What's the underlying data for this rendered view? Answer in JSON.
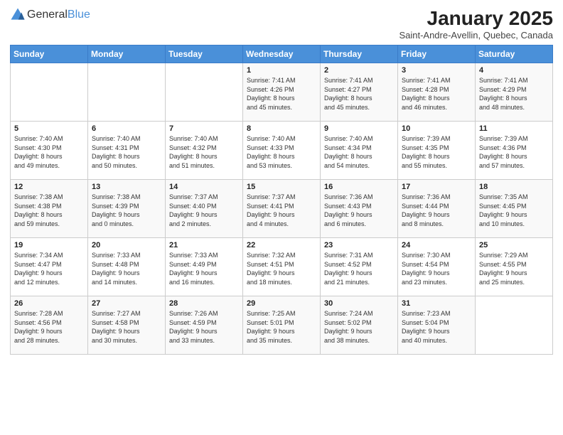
{
  "header": {
    "logo_general": "General",
    "logo_blue": "Blue",
    "month_title": "January 2025",
    "location": "Saint-Andre-Avellin, Quebec, Canada"
  },
  "weekdays": [
    "Sunday",
    "Monday",
    "Tuesday",
    "Wednesday",
    "Thursday",
    "Friday",
    "Saturday"
  ],
  "weeks": [
    [
      {
        "day": "",
        "info": ""
      },
      {
        "day": "",
        "info": ""
      },
      {
        "day": "",
        "info": ""
      },
      {
        "day": "1",
        "info": "Sunrise: 7:41 AM\nSunset: 4:26 PM\nDaylight: 8 hours\nand 45 minutes."
      },
      {
        "day": "2",
        "info": "Sunrise: 7:41 AM\nSunset: 4:27 PM\nDaylight: 8 hours\nand 45 minutes."
      },
      {
        "day": "3",
        "info": "Sunrise: 7:41 AM\nSunset: 4:28 PM\nDaylight: 8 hours\nand 46 minutes."
      },
      {
        "day": "4",
        "info": "Sunrise: 7:41 AM\nSunset: 4:29 PM\nDaylight: 8 hours\nand 48 minutes."
      }
    ],
    [
      {
        "day": "5",
        "info": "Sunrise: 7:40 AM\nSunset: 4:30 PM\nDaylight: 8 hours\nand 49 minutes."
      },
      {
        "day": "6",
        "info": "Sunrise: 7:40 AM\nSunset: 4:31 PM\nDaylight: 8 hours\nand 50 minutes."
      },
      {
        "day": "7",
        "info": "Sunrise: 7:40 AM\nSunset: 4:32 PM\nDaylight: 8 hours\nand 51 minutes."
      },
      {
        "day": "8",
        "info": "Sunrise: 7:40 AM\nSunset: 4:33 PM\nDaylight: 8 hours\nand 53 minutes."
      },
      {
        "day": "9",
        "info": "Sunrise: 7:40 AM\nSunset: 4:34 PM\nDaylight: 8 hours\nand 54 minutes."
      },
      {
        "day": "10",
        "info": "Sunrise: 7:39 AM\nSunset: 4:35 PM\nDaylight: 8 hours\nand 55 minutes."
      },
      {
        "day": "11",
        "info": "Sunrise: 7:39 AM\nSunset: 4:36 PM\nDaylight: 8 hours\nand 57 minutes."
      }
    ],
    [
      {
        "day": "12",
        "info": "Sunrise: 7:38 AM\nSunset: 4:38 PM\nDaylight: 8 hours\nand 59 minutes."
      },
      {
        "day": "13",
        "info": "Sunrise: 7:38 AM\nSunset: 4:39 PM\nDaylight: 9 hours\nand 0 minutes."
      },
      {
        "day": "14",
        "info": "Sunrise: 7:37 AM\nSunset: 4:40 PM\nDaylight: 9 hours\nand 2 minutes."
      },
      {
        "day": "15",
        "info": "Sunrise: 7:37 AM\nSunset: 4:41 PM\nDaylight: 9 hours\nand 4 minutes."
      },
      {
        "day": "16",
        "info": "Sunrise: 7:36 AM\nSunset: 4:43 PM\nDaylight: 9 hours\nand 6 minutes."
      },
      {
        "day": "17",
        "info": "Sunrise: 7:36 AM\nSunset: 4:44 PM\nDaylight: 9 hours\nand 8 minutes."
      },
      {
        "day": "18",
        "info": "Sunrise: 7:35 AM\nSunset: 4:45 PM\nDaylight: 9 hours\nand 10 minutes."
      }
    ],
    [
      {
        "day": "19",
        "info": "Sunrise: 7:34 AM\nSunset: 4:47 PM\nDaylight: 9 hours\nand 12 minutes."
      },
      {
        "day": "20",
        "info": "Sunrise: 7:33 AM\nSunset: 4:48 PM\nDaylight: 9 hours\nand 14 minutes."
      },
      {
        "day": "21",
        "info": "Sunrise: 7:33 AM\nSunset: 4:49 PM\nDaylight: 9 hours\nand 16 minutes."
      },
      {
        "day": "22",
        "info": "Sunrise: 7:32 AM\nSunset: 4:51 PM\nDaylight: 9 hours\nand 18 minutes."
      },
      {
        "day": "23",
        "info": "Sunrise: 7:31 AM\nSunset: 4:52 PM\nDaylight: 9 hours\nand 21 minutes."
      },
      {
        "day": "24",
        "info": "Sunrise: 7:30 AM\nSunset: 4:54 PM\nDaylight: 9 hours\nand 23 minutes."
      },
      {
        "day": "25",
        "info": "Sunrise: 7:29 AM\nSunset: 4:55 PM\nDaylight: 9 hours\nand 25 minutes."
      }
    ],
    [
      {
        "day": "26",
        "info": "Sunrise: 7:28 AM\nSunset: 4:56 PM\nDaylight: 9 hours\nand 28 minutes."
      },
      {
        "day": "27",
        "info": "Sunrise: 7:27 AM\nSunset: 4:58 PM\nDaylight: 9 hours\nand 30 minutes."
      },
      {
        "day": "28",
        "info": "Sunrise: 7:26 AM\nSunset: 4:59 PM\nDaylight: 9 hours\nand 33 minutes."
      },
      {
        "day": "29",
        "info": "Sunrise: 7:25 AM\nSunset: 5:01 PM\nDaylight: 9 hours\nand 35 minutes."
      },
      {
        "day": "30",
        "info": "Sunrise: 7:24 AM\nSunset: 5:02 PM\nDaylight: 9 hours\nand 38 minutes."
      },
      {
        "day": "31",
        "info": "Sunrise: 7:23 AM\nSunset: 5:04 PM\nDaylight: 9 hours\nand 40 minutes."
      },
      {
        "day": "",
        "info": ""
      }
    ]
  ]
}
